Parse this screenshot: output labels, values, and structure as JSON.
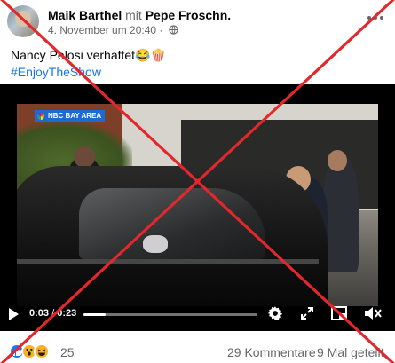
{
  "post": {
    "author": "Maik Barthel",
    "with_word": "mit",
    "tagged": "Pepe Froschn.",
    "timestamp": "4. November um 20:40",
    "dot": "·",
    "privacy_icon": "globe-icon",
    "text": "Nancy Pelosi verhaftet😂🍿",
    "hashtag": "#EnjoyTheShow"
  },
  "video": {
    "channel_tag": "NBC BAY AREA",
    "current_time": "0:03",
    "separator": "/",
    "duration": "0:23",
    "progress": 0.13,
    "icons": [
      "play-icon",
      "gear-icon",
      "fullscreen-icon",
      "picture-in-picture-icon",
      "mute-icon"
    ]
  },
  "footer": {
    "reaction_icons": [
      "like-icon",
      "wow-icon",
      "haha-icon"
    ],
    "reaction_count": "25",
    "comments": "29 Kommentare",
    "shares": "9 Mal geteilt"
  },
  "colors": {
    "link_blue": "#1b74e4",
    "muted_text": "#65676b",
    "fact_check_cross": "#e2282c"
  }
}
